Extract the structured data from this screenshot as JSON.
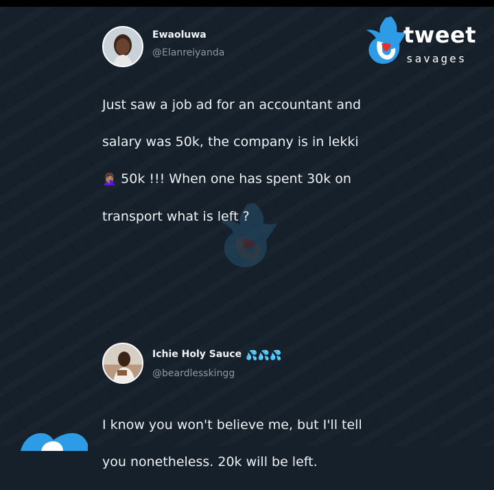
{
  "brand": {
    "word": "tweet",
    "sub": "savages",
    "colors": {
      "blue": "#2e9be6",
      "red": "#e0322f",
      "white": "#ffffff",
      "background": "#15202b"
    }
  },
  "tweets": [
    {
      "name": "Ewaoluwa",
      "handle": "@Elanreiyanda",
      "lines": [
        "Just saw a job ad for an accountant and",
        "salary was 50k, the company is in lekki",
        "50k !!! When one has spent 30k on",
        "transport what is left ?"
      ],
      "inline_emoji": "🤦🏽‍♀️"
    },
    {
      "name": "Ichie Holy Sauce",
      "name_badges": "💦💦💦",
      "handle": "@beardlesskingg",
      "lines": [
        "I know you won't believe me, but I'll tell",
        "you nonetheless. 20k will be left."
      ]
    }
  ]
}
